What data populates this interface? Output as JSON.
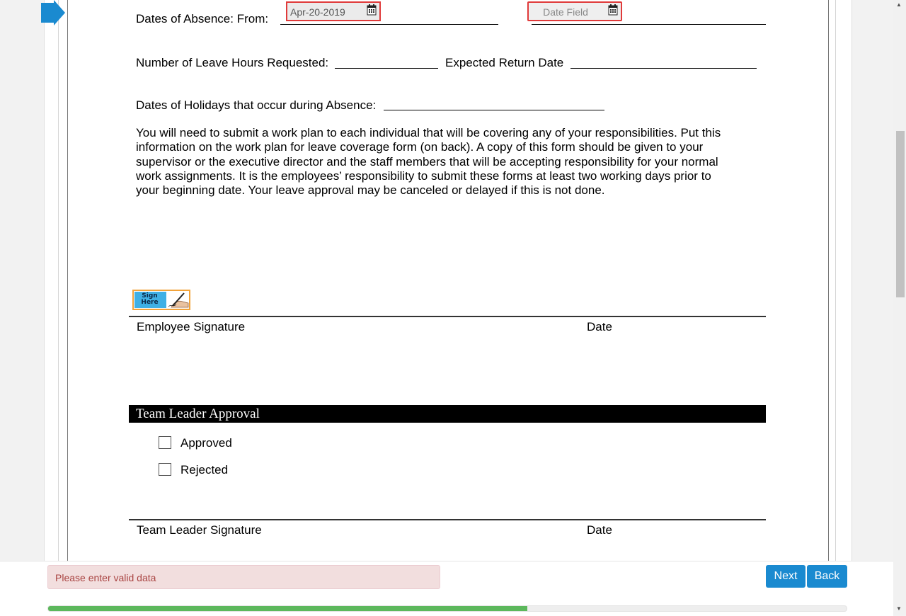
{
  "form": {
    "absence_label": "Dates of Absence: From:",
    "date_from_value": "Apr-20-2019",
    "date_to_placeholder": "Date Field",
    "leave_hours_label": "Number of Leave Hours Requested:",
    "expected_return_label": "Expected Return Date",
    "holidays_label": "Dates of Holidays that occur during Absence:",
    "instructions": [
      "You will need to submit a work plan to each individual that will be covering any of your responsibilities.  Put this",
      "information on the work plan for leave coverage form (on back).  A copy of this form should be given to your",
      "supervisor or the executive director and the staff members that will be accepting responsibility for your normal",
      "work assignments.  It is the employees’ responsibility to submit these forms at least two working days prior to",
      "your beginning date.  Your leave approval may be canceled or delayed if this is not done."
    ],
    "sign_here_label": "Sign Here",
    "employee_signature_label": "Employee Signature",
    "employee_date_label": "Date",
    "team_leader_section_title": "Team Leader Approval",
    "approved_label": "Approved",
    "rejected_label": "Rejected",
    "team_leader_signature_label": "Team Leader Signature",
    "team_leader_date_label": "Date"
  },
  "footer": {
    "error_message": "Please enter valid data",
    "next_label": "Next",
    "back_label": "Back",
    "progress_fraction": 0.6
  },
  "colors": {
    "accent": "#1a8ad0",
    "error_border": "#e03a3a",
    "progress": "#5cb85c",
    "error_bg": "#f2dede"
  },
  "icons": [
    "current-field-arrow-icon",
    "calendar-icon",
    "sign-here-icon",
    "scroll-up-icon",
    "scroll-down-icon"
  ]
}
